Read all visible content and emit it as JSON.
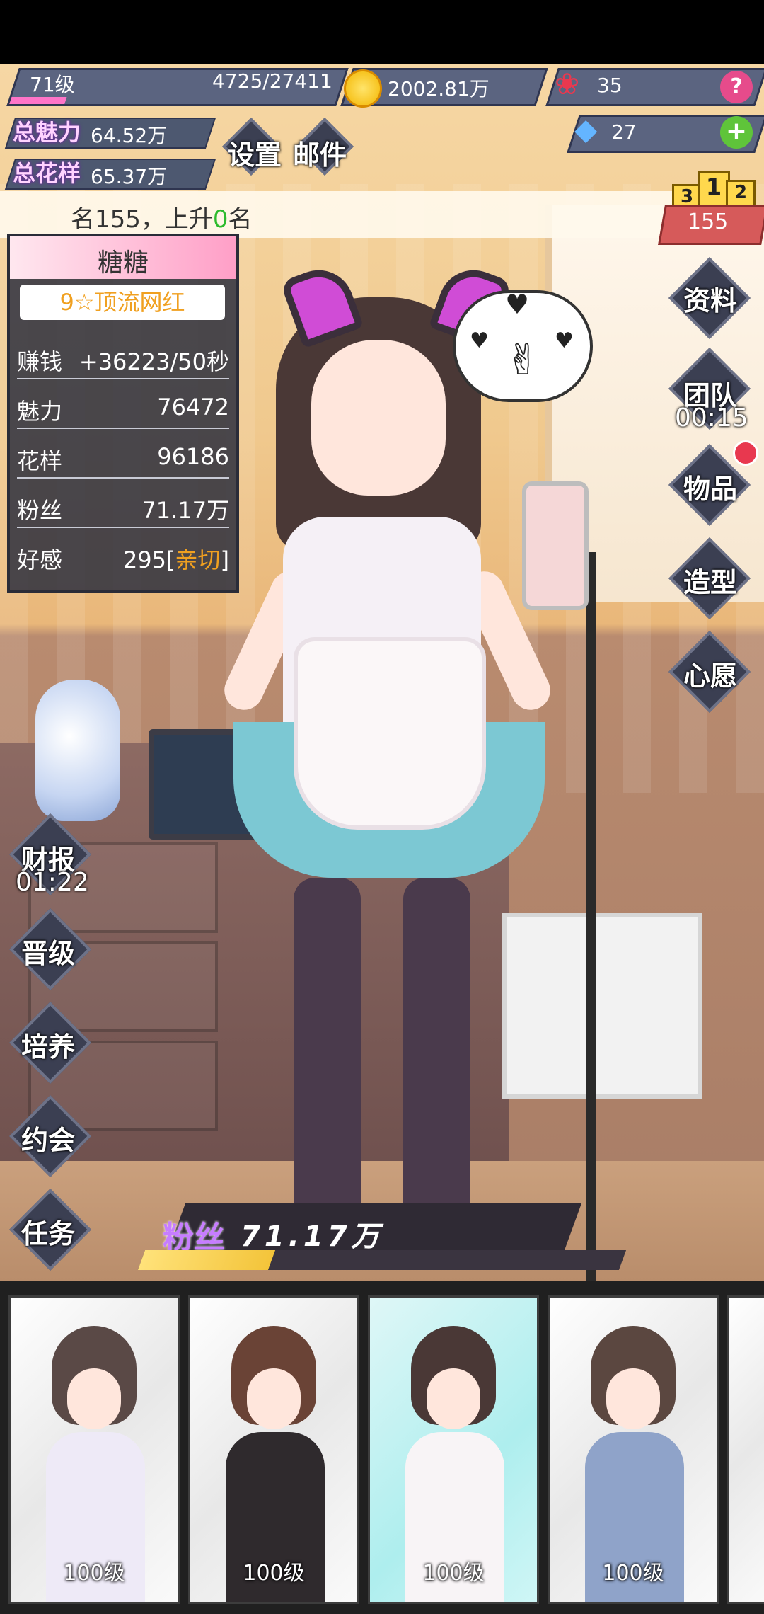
{
  "hud": {
    "level_label": "71级",
    "exp_text": "4725/27411",
    "exp_progress": 0.17,
    "gold": "2002.81万",
    "roses": "35",
    "diamonds": "27",
    "help_icon": "?",
    "add_icon": "+"
  },
  "stats": {
    "charm_label": "总魅力",
    "charm_value": "64.52万",
    "style_label": "总花样",
    "style_value": "65.37万"
  },
  "top_buttons": {
    "settings": "设置",
    "mail": "邮件"
  },
  "rank": {
    "text_prefix": "名155，上升",
    "text_rise": "0",
    "text_suffix": "名",
    "podium_1": "1",
    "podium_2": "2",
    "podium_3": "3",
    "number": "155"
  },
  "character": {
    "name": "糖糖",
    "title": "9☆顶流网红",
    "rows": [
      {
        "label": "赚钱",
        "value": "+36223/50秒"
      },
      {
        "label": "魅力",
        "value": "76472"
      },
      {
        "label": "花样",
        "value": "96186"
      },
      {
        "label": "粉丝",
        "value": "71.17万"
      },
      {
        "label": "好感",
        "value": "295",
        "bracket_open": "[",
        "highlight": "亲切",
        "bracket_close": "]"
      }
    ]
  },
  "right_menu": {
    "profile": "资料",
    "team": "团队",
    "team_timer": "00:15",
    "items": "物品",
    "styling": "造型",
    "wish": "心愿"
  },
  "left_menu": {
    "report": "财报",
    "report_timer": "01:22",
    "promote": "晋级",
    "train": "培养",
    "date": "约会",
    "tasks": "任务"
  },
  "fans_bar": {
    "label": "粉丝",
    "value": "71.17万",
    "progress": 0.27
  },
  "roster": [
    {
      "level": "100级"
    },
    {
      "level": "100级"
    },
    {
      "level": "100级"
    },
    {
      "level": "100级"
    }
  ],
  "colors": {
    "accent_pink": "#ff74c8",
    "gold_text": "#f0a020",
    "rise_green": "#2dbb2d",
    "badge_red": "#e8384f"
  }
}
